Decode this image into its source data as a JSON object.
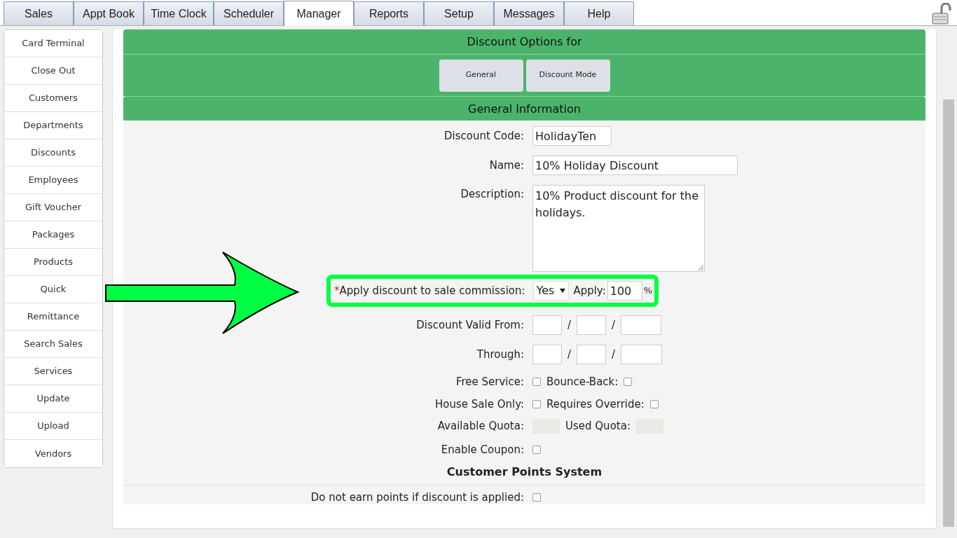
{
  "tabs": [
    {
      "label": "Sales",
      "selected": false
    },
    {
      "label": "Appt Book",
      "selected": false
    },
    {
      "label": "Time Clock",
      "selected": false
    },
    {
      "label": "Scheduler",
      "selected": false
    },
    {
      "label": "Manager",
      "selected": true
    },
    {
      "label": "Reports",
      "selected": false
    },
    {
      "label": "Setup",
      "selected": false
    },
    {
      "label": "Messages",
      "selected": false
    },
    {
      "label": "Help",
      "selected": false
    }
  ],
  "sidebar": {
    "items": [
      {
        "label": "Card Terminal"
      },
      {
        "label": "Close Out"
      },
      {
        "label": "Customers"
      },
      {
        "label": "Departments"
      },
      {
        "label": "Discounts"
      },
      {
        "label": "Employees"
      },
      {
        "label": "Gift Voucher"
      },
      {
        "label": "Packages"
      },
      {
        "label": "Products"
      },
      {
        "label": "Quick"
      },
      {
        "label": "Remittance"
      },
      {
        "label": "Search Sales"
      },
      {
        "label": "Services"
      },
      {
        "label": "Update"
      },
      {
        "label": "Upload"
      },
      {
        "label": "Vendors"
      }
    ]
  },
  "panel": {
    "title": "Discount Options for",
    "buttons": [
      "General",
      "Discount Mode"
    ],
    "section_title": "General Information"
  },
  "fields": [
    {
      "kind": "short_text",
      "label": "Discount Code:",
      "value": "HolidayTen"
    },
    {
      "kind": "text",
      "label": "Name:",
      "value": "10% Holiday Discount"
    },
    {
      "kind": "textarea",
      "label": "Description:",
      "value": "10% Product discount for the holidays."
    },
    {
      "kind": "commission",
      "required_mark": "*",
      "label": "Apply discount to sale commission:",
      "select_value": "Yes",
      "apply_label": "Apply:",
      "apply_value": "100",
      "unit": "%",
      "highlighted": true
    },
    {
      "kind": "date",
      "label": "Discount Valid From:",
      "separator_1": "/",
      "separator_2": "/"
    },
    {
      "kind": "date",
      "label": "Through:",
      "separator_1": "/",
      "separator_2": "/"
    },
    {
      "kind": "check_pair",
      "label": "Free Service:",
      "checked": false,
      "label_2": "Bounce-Back:",
      "checked_2": false
    },
    {
      "kind": "check_pair",
      "label": "House Sale Only:",
      "checked": false,
      "label_2": "Requires Override:",
      "checked_2": false
    },
    {
      "kind": "readonly_pair",
      "label": "Available Quota:",
      "label_2": "Used Quota:"
    },
    {
      "kind": "check",
      "label": "Enable Coupon:",
      "checked": false
    },
    {
      "kind": "heading",
      "label": "Customer Points System"
    },
    {
      "kind": "check",
      "label": "Do not earn points if discount is applied:",
      "checked": false,
      "divider_above": true
    }
  ],
  "annotation": {
    "kind": "arrow"
  }
}
